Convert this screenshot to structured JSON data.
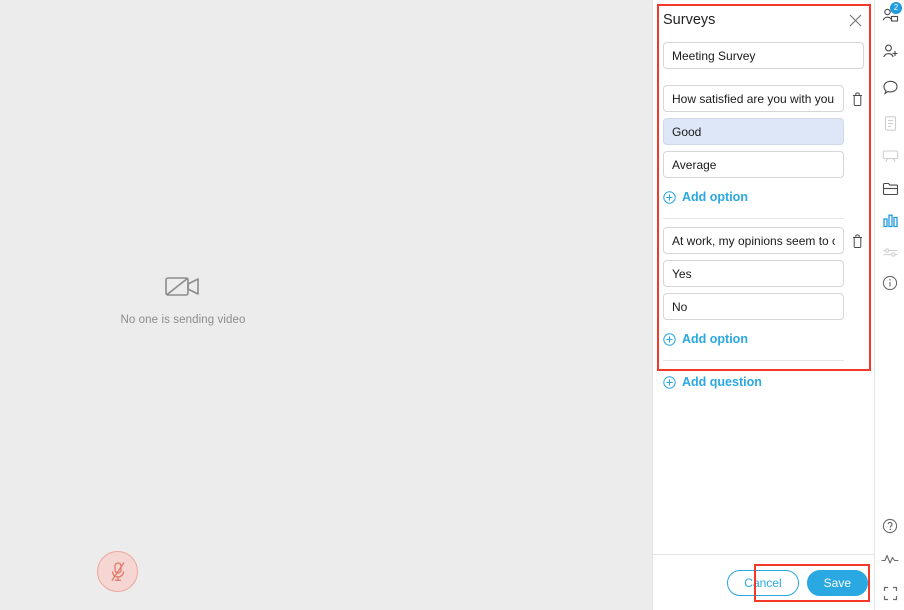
{
  "stage": {
    "no_video_text": "No one is sending video",
    "camera_off_icon": "camera-off-icon",
    "mute_icon": "microphone-muted-icon"
  },
  "survey": {
    "title": "Surveys",
    "close_icon": "close-icon",
    "name_value": "Meeting Survey",
    "questions": [
      {
        "text": "How satisfied are you with your c",
        "delete_icon": "trash-icon",
        "options": [
          {
            "text": "Good",
            "selected": true
          },
          {
            "text": "Average",
            "selected": false
          }
        ],
        "add_option_label": "Add option"
      },
      {
        "text": "At work, my opinions seem to co",
        "delete_icon": "trash-icon",
        "options": [
          {
            "text": "Yes",
            "selected": false
          },
          {
            "text": "No",
            "selected": false
          }
        ],
        "add_option_label": "Add option"
      }
    ],
    "add_question_label": "Add question"
  },
  "footer": {
    "cancel_label": "Cancel",
    "save_label": "Save"
  },
  "rail": {
    "items": [
      {
        "name": "participants-icon",
        "badge": "2",
        "active": false,
        "dim": false
      },
      {
        "name": "invite-user-icon",
        "badge": "",
        "active": false,
        "dim": false
      },
      {
        "name": "chat-icon",
        "badge": "",
        "active": false,
        "dim": false
      },
      {
        "name": "notes-icon",
        "badge": "",
        "active": false,
        "dim": true
      },
      {
        "name": "whiteboard-icon",
        "badge": "",
        "active": false,
        "dim": true
      },
      {
        "name": "files-icon",
        "badge": "",
        "active": false,
        "dim": false
      },
      {
        "name": "polls-chart-icon",
        "badge": "",
        "active": true,
        "dim": false
      },
      {
        "name": "settings-sliders-icon",
        "badge": "",
        "active": false,
        "dim": true
      },
      {
        "name": "info-icon",
        "badge": "",
        "active": false,
        "dim": false
      },
      {
        "name": "help-icon",
        "badge": "",
        "active": false,
        "dim": false
      },
      {
        "name": "network-activity-icon",
        "badge": "",
        "active": false,
        "dim": false
      },
      {
        "name": "fullscreen-icon",
        "badge": "",
        "active": false,
        "dim": false
      }
    ]
  },
  "colors": {
    "accent": "#2aa8e2",
    "annotation": "#f4392a",
    "selected_option_bg": "#dde7f7",
    "stage_bg": "#ececec"
  }
}
